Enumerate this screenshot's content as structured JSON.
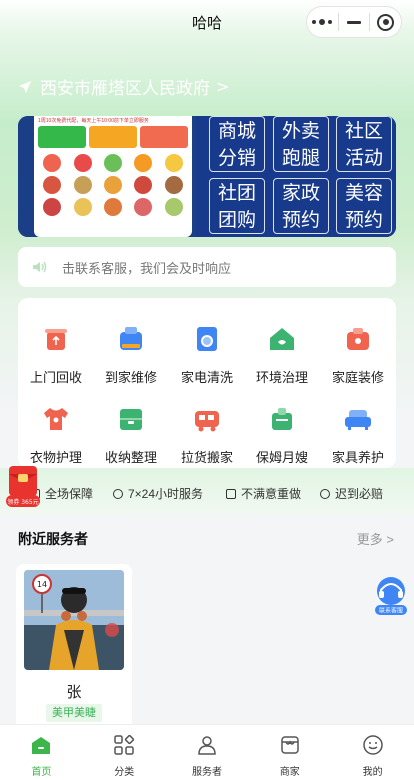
{
  "navbar": {
    "title": "哈哈"
  },
  "location": {
    "name": "西安市雁塔区人民政府",
    "arrow": ">"
  },
  "banner": {
    "phone_strip": "1周10次免费代配，每天上午10:00前下单立即服务",
    "tiles": [
      "商城分销",
      "外卖跑腿",
      "社区活动",
      "社团团购",
      "家政预约",
      "美容预约"
    ],
    "tile_lines": [
      [
        "商城",
        "分销"
      ],
      [
        "外卖",
        "跑腿"
      ],
      [
        "社区",
        "活动"
      ],
      [
        "社团",
        "团购"
      ],
      [
        "家政",
        "预约"
      ],
      [
        "美容",
        "预约"
      ]
    ]
  },
  "notice": {
    "text": "击联系客服，我们会及时响应"
  },
  "services": [
    {
      "label": "上门回收",
      "icon": "recycle-bin-icon",
      "color": "#f0634f"
    },
    {
      "label": "到家维修",
      "icon": "repair-icon",
      "color": "#3f86f4"
    },
    {
      "label": "家电清洗",
      "icon": "washing-machine-icon",
      "color": "#3f86f4"
    },
    {
      "label": "环境治理",
      "icon": "house-icon",
      "color": "#3cb371"
    },
    {
      "label": "家庭装修",
      "icon": "toolbox-icon",
      "color": "#f0634f"
    },
    {
      "label": "衣物护理",
      "icon": "shirt-icon",
      "color": "#f0634f"
    },
    {
      "label": "收纳整理",
      "icon": "storage-box-icon",
      "color": "#3cb371"
    },
    {
      "label": "拉货搬家",
      "icon": "truck-icon",
      "color": "#f0634f"
    },
    {
      "label": "保姆月嫂",
      "icon": "nanny-icon",
      "color": "#3cb371"
    },
    {
      "label": "家具养护",
      "icon": "sofa-icon",
      "color": "#3f86f4"
    }
  ],
  "guarantees": [
    "全场保障",
    "7×24小时服务",
    "不满意重做",
    "迟到必赔"
  ],
  "redpacket": {
    "label": "领券 365元"
  },
  "nearby": {
    "title": "附近服务者",
    "more": "更多 >",
    "providers": [
      {
        "name": "张",
        "tag": "美甲美睫",
        "photo_sign": "14"
      }
    ]
  },
  "support": {
    "label": "联系客服"
  },
  "tabbar": [
    {
      "label": "首页",
      "icon": "home-icon",
      "active": true
    },
    {
      "label": "分类",
      "icon": "category-icon",
      "active": false
    },
    {
      "label": "服务者",
      "icon": "provider-icon",
      "active": false
    },
    {
      "label": "商家",
      "icon": "shop-icon",
      "active": false
    },
    {
      "label": "我的",
      "icon": "profile-icon",
      "active": false
    }
  ],
  "colors": {
    "accent": "#3cb54a",
    "banner_blue": "#173a8c",
    "location_text": "#ffffff"
  }
}
